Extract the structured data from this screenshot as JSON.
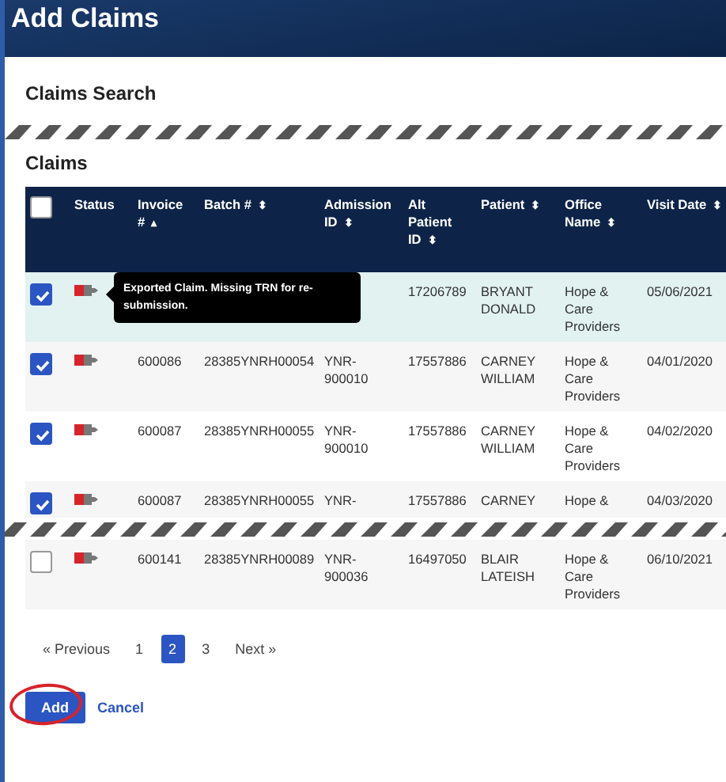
{
  "page_title": "Add Claims",
  "search_section": {
    "title": "Claims Search"
  },
  "claims": {
    "title": "Claims",
    "select_all": {
      "checked": false
    },
    "columns": [
      {
        "label": "Status"
      },
      {
        "label": "Invoice #",
        "sort": "▴"
      },
      {
        "label": "Batch #",
        "sort": "⬍"
      },
      {
        "label": "Admission ID",
        "sort": "⬍"
      },
      {
        "label": "Alt Patient ID",
        "sort": "⬍"
      },
      {
        "label": "Patient",
        "sort": "⬍"
      },
      {
        "label": "Office Name",
        "sort": "⬍"
      },
      {
        "label": "Visit Date",
        "sort": "⬍"
      }
    ],
    "rows": [
      {
        "checked": true,
        "highlighted": true,
        "tooltip": "Exported Claim. Missing TRN for re-submission.",
        "invoice": "",
        "batch": "",
        "admission": "",
        "alt_patient_id": "17206789",
        "patient": "BRYANT DONALD",
        "office": "Hope & Care Providers",
        "visit_date": "05/06/2021"
      },
      {
        "checked": true,
        "highlighted": false,
        "invoice": "600086",
        "batch": "28385YNRH00054",
        "admission": "YNR-900010",
        "alt_patient_id": "17557886",
        "patient": "CARNEY WILLIAM",
        "office": "Hope & Care Providers",
        "visit_date": "04/01/2020"
      },
      {
        "checked": true,
        "highlighted": false,
        "invoice": "600087",
        "batch": "28385YNRH00055",
        "admission": "YNR-900010",
        "alt_patient_id": "17557886",
        "patient": "CARNEY WILLIAM",
        "office": "Hope & Care Providers",
        "visit_date": "04/02/2020"
      },
      {
        "checked": true,
        "highlighted": false,
        "torn": true,
        "invoice": "600087",
        "batch": "28385YNRH00055",
        "admission": "YNR-",
        "alt_patient_id": "17557886",
        "patient": "CARNEY",
        "office": "Hope &",
        "visit_date": "04/03/2020"
      },
      {
        "checked": false,
        "highlighted": false,
        "invoice": "600141",
        "batch": "28385YNRH00089",
        "admission": "YNR-900036",
        "alt_patient_id": "16497050",
        "patient": "BLAIR LATEISH",
        "office": "Hope & Care Providers",
        "visit_date": "06/10/2021"
      }
    ]
  },
  "pagination": {
    "previous": "« Previous",
    "pages": [
      {
        "label": "1",
        "selected": false
      },
      {
        "label": "2",
        "selected": true
      },
      {
        "label": "3",
        "selected": false
      }
    ],
    "next": "Next »"
  },
  "buttons": {
    "add": "Add",
    "cancel": "Cancel"
  }
}
